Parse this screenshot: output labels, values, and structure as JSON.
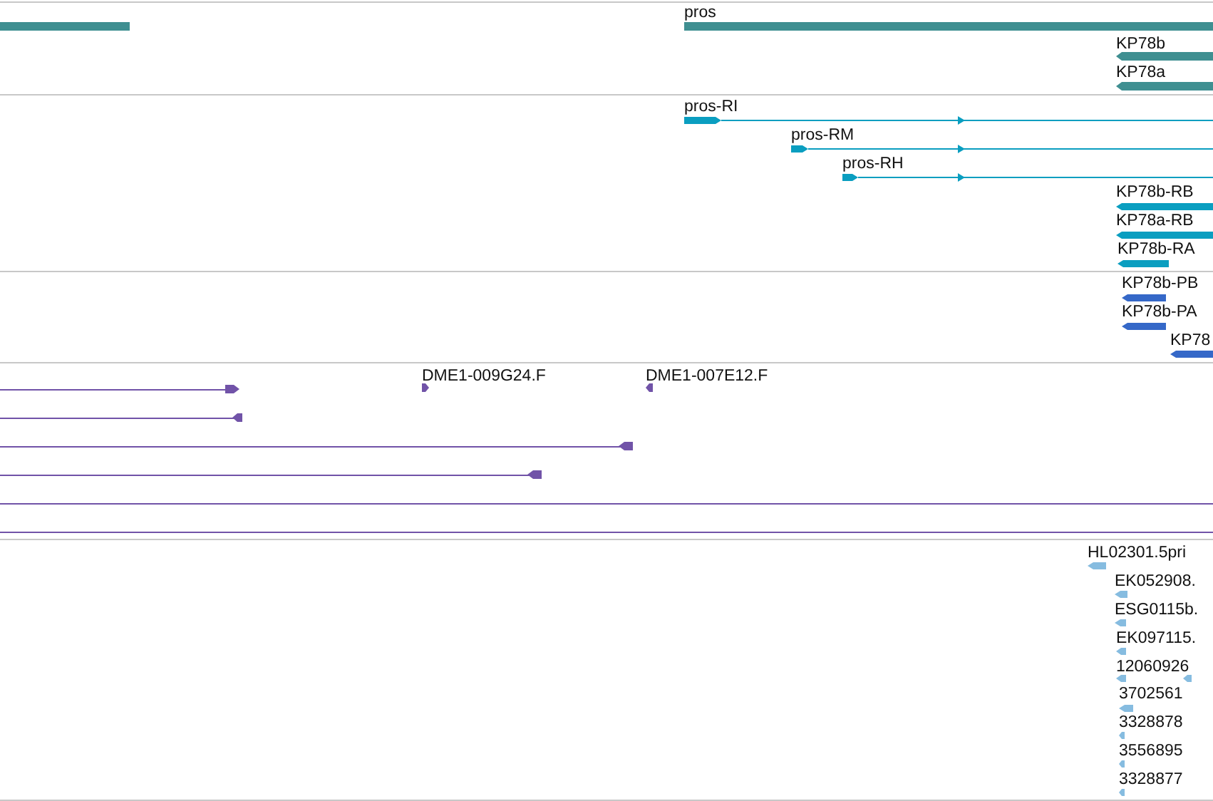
{
  "tracks": [
    {
      "kind": "gene",
      "features": [
        {
          "label": "pros"
        },
        {
          "label": "KP78b"
        },
        {
          "label": "KP78a"
        }
      ]
    },
    {
      "kind": "transcript",
      "features": [
        {
          "label": "pros-RI"
        },
        {
          "label": "pros-RM"
        },
        {
          "label": "pros-RH"
        },
        {
          "label": "KP78b-RB"
        },
        {
          "label": "KP78a-RB"
        },
        {
          "label": "KP78b-RA"
        }
      ]
    },
    {
      "kind": "protein",
      "features": [
        {
          "label": "KP78b-PB"
        },
        {
          "label": "KP78b-PA"
        },
        {
          "label": "KP78"
        }
      ]
    },
    {
      "kind": "alignment",
      "features": [
        {
          "label": "DME1-009G24.F"
        },
        {
          "label": "DME1-007E12.F"
        }
      ]
    },
    {
      "kind": "est",
      "features": [
        {
          "label": "HL02301.5pri"
        },
        {
          "label": "EK052908."
        },
        {
          "label": "ESG0115b."
        },
        {
          "label": "EK097115."
        },
        {
          "label": "12060926"
        },
        {
          "label": "3702561"
        },
        {
          "label": "3328878"
        },
        {
          "label": "3556895"
        },
        {
          "label": "3328877"
        }
      ]
    }
  ]
}
